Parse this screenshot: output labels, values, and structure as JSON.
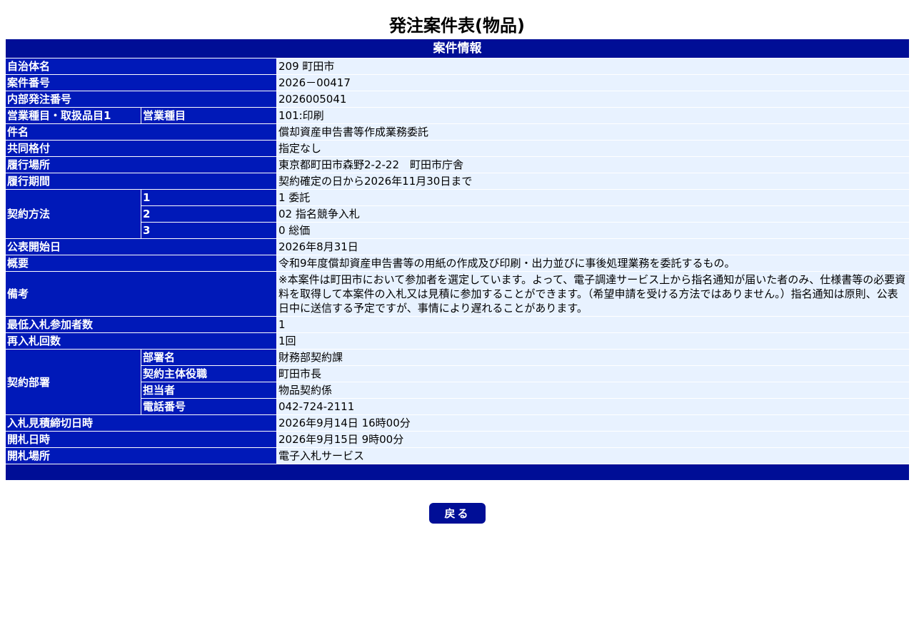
{
  "title": "発注案件表(物品)",
  "section_header": "案件情報",
  "rows": {
    "jichitai": {
      "label": "自治体名",
      "value": "209 町田市"
    },
    "anken_bango": {
      "label": "案件番号",
      "value": "2026－00417"
    },
    "naibu_bango": {
      "label": "内部発注番号",
      "value": "2026005041"
    },
    "eigyo": {
      "label": "営業種目・取扱品目1",
      "sublabel": "営業種目",
      "value": "101:印刷"
    },
    "kenmei": {
      "label": "件名",
      "value": "償却資産申告書等作成業務委託"
    },
    "kyodo": {
      "label": "共同格付",
      "value": "指定なし"
    },
    "basho": {
      "label": "履行場所",
      "value": "東京都町田市森野2-2-22　町田市庁舎"
    },
    "kikan": {
      "label": "履行期間",
      "value": "契約確定の日から2026年11月30日まで"
    },
    "hoho": {
      "label": "契約方法",
      "items": [
        {
          "no": "1",
          "value": "1 委託"
        },
        {
          "no": "2",
          "value": "02 指名競争入札"
        },
        {
          "no": "3",
          "value": "0 総価"
        }
      ]
    },
    "kohyo": {
      "label": "公表開始日",
      "value": "2026年8月31日"
    },
    "gaiyo": {
      "label": "概要",
      "value": "令和9年度償却資産申告書等の用紙の作成及び印刷・出力並びに事後処理業務を委託するもの。"
    },
    "biko": {
      "label": "備考",
      "value": "※本案件は町田市において参加者を選定しています。よって、電子調達サービス上から指名通知が届いた者のみ、仕様書等の必要資料を取得して本案件の入札又は見積に参加することができます。（希望申請を受ける方法ではありません。）指名通知は原則、公表日中に送信する予定ですが、事情により遅れることがあります。"
    },
    "saitei": {
      "label": "最低入札参加者数",
      "value": "1"
    },
    "sainyusatsu": {
      "label": "再入札回数",
      "value": "1回"
    },
    "busho": {
      "label": "契約部署",
      "items": [
        {
          "label": "部署名",
          "value": "財務部契約課"
        },
        {
          "label": "契約主体役職",
          "value": "町田市長"
        },
        {
          "label": "担当者",
          "value": "物品契約係"
        },
        {
          "label": "電話番号",
          "value": "042-724-2111"
        }
      ]
    },
    "shimekiri": {
      "label": "入札見積締切日時",
      "value": "2026年9月14日 16時00分"
    },
    "kaisatsu_nichiji": {
      "label": "開札日時",
      "value": "2026年9月15日 9時00分"
    },
    "kaisatsu_basho": {
      "label": "開札場所",
      "value": "電子入札サービス"
    }
  },
  "back_label": "戻る",
  "colors": {
    "header": "#000e96",
    "label": "#0019b8",
    "value_bg": "#e8f2ff"
  }
}
